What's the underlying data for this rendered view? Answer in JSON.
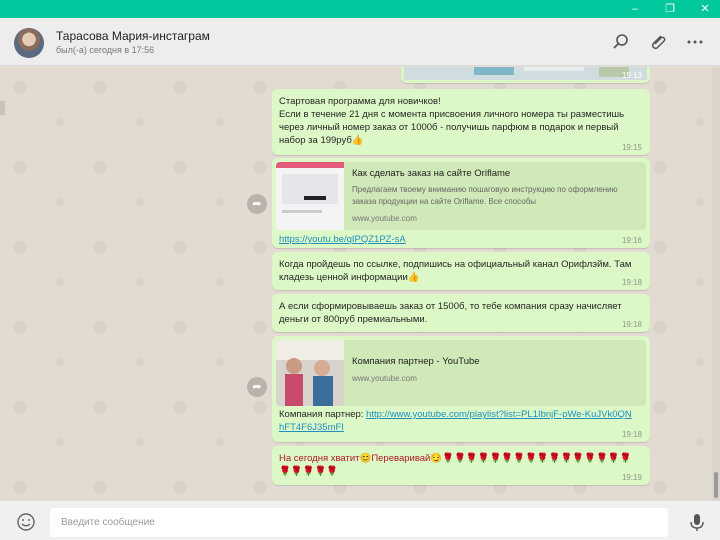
{
  "window": {
    "minimize_icon": "minimize-icon",
    "maximize_icon": "maximize-icon",
    "close_icon": "close-icon"
  },
  "header": {
    "contact_name": "Тарасова Мария-инстаграм",
    "status": "был(-а) сегодня в 17:56",
    "actions": [
      "search-icon",
      "paperclip-icon",
      "menu-dots-icon"
    ]
  },
  "messages": {
    "image_time": "19:13",
    "m1": {
      "text": "Стартовая программа для новичков!\nЕсли в течение 21 дня с момента присвоения личного номера ты разместишь через личный номер заказ от 1000б - получишь парфюм в подарок и первый набор за 199руб👍",
      "time": "19:15"
    },
    "m2": {
      "preview_title": "Как сделать заказ на сайте Oriflame",
      "preview_desc": "Предлагаем твоему вниманию пошаговую инструкцию по оформлению заказа продукции на сайте Oriflame. Все способы",
      "preview_domain": "www.youtube.com",
      "link": "https://youtu.be/qIPQZ1PZ-sA",
      "time": "19:16"
    },
    "m3": {
      "text": "Когда пройдешь по ссылке, подпишись на официальный канал Орифлэйм. Там кладезь ценной информации👍",
      "time": "19:18"
    },
    "m4": {
      "text": "А если сформировываешь заказ от 1500б, то тебе компания сразу начисляет деньги от 800руб премиальными.",
      "time": "19:18"
    },
    "m5": {
      "preview_title": "Компания партнер - YouTube",
      "preview_domain": "www.youtube.com",
      "prefix": "Компания партнер:",
      "link": "http://www.youtube.com/playlist?list=PL1IbnjF-pWe-KuJVk0QNhFT4F6J35mFI",
      "time": "19:18"
    },
    "m6": {
      "text": "На сегодня хватит😊Переваривай😏🌹🌹🌹🌹🌹🌹🌹🌹🌹🌹🌹🌹🌹🌹🌹🌹🌹🌹🌹🌹🌹",
      "time": "19:19"
    }
  },
  "compose": {
    "placeholder": "Введите сообщение",
    "emoji_icon": "emoji-icon",
    "mic_icon": "microphone-icon"
  },
  "colors": {
    "titlebar": "#00c79c",
    "bubble_out": "#dcf8c6",
    "link": "#1e8fc0",
    "chat_bg": "#e2dbd2"
  }
}
